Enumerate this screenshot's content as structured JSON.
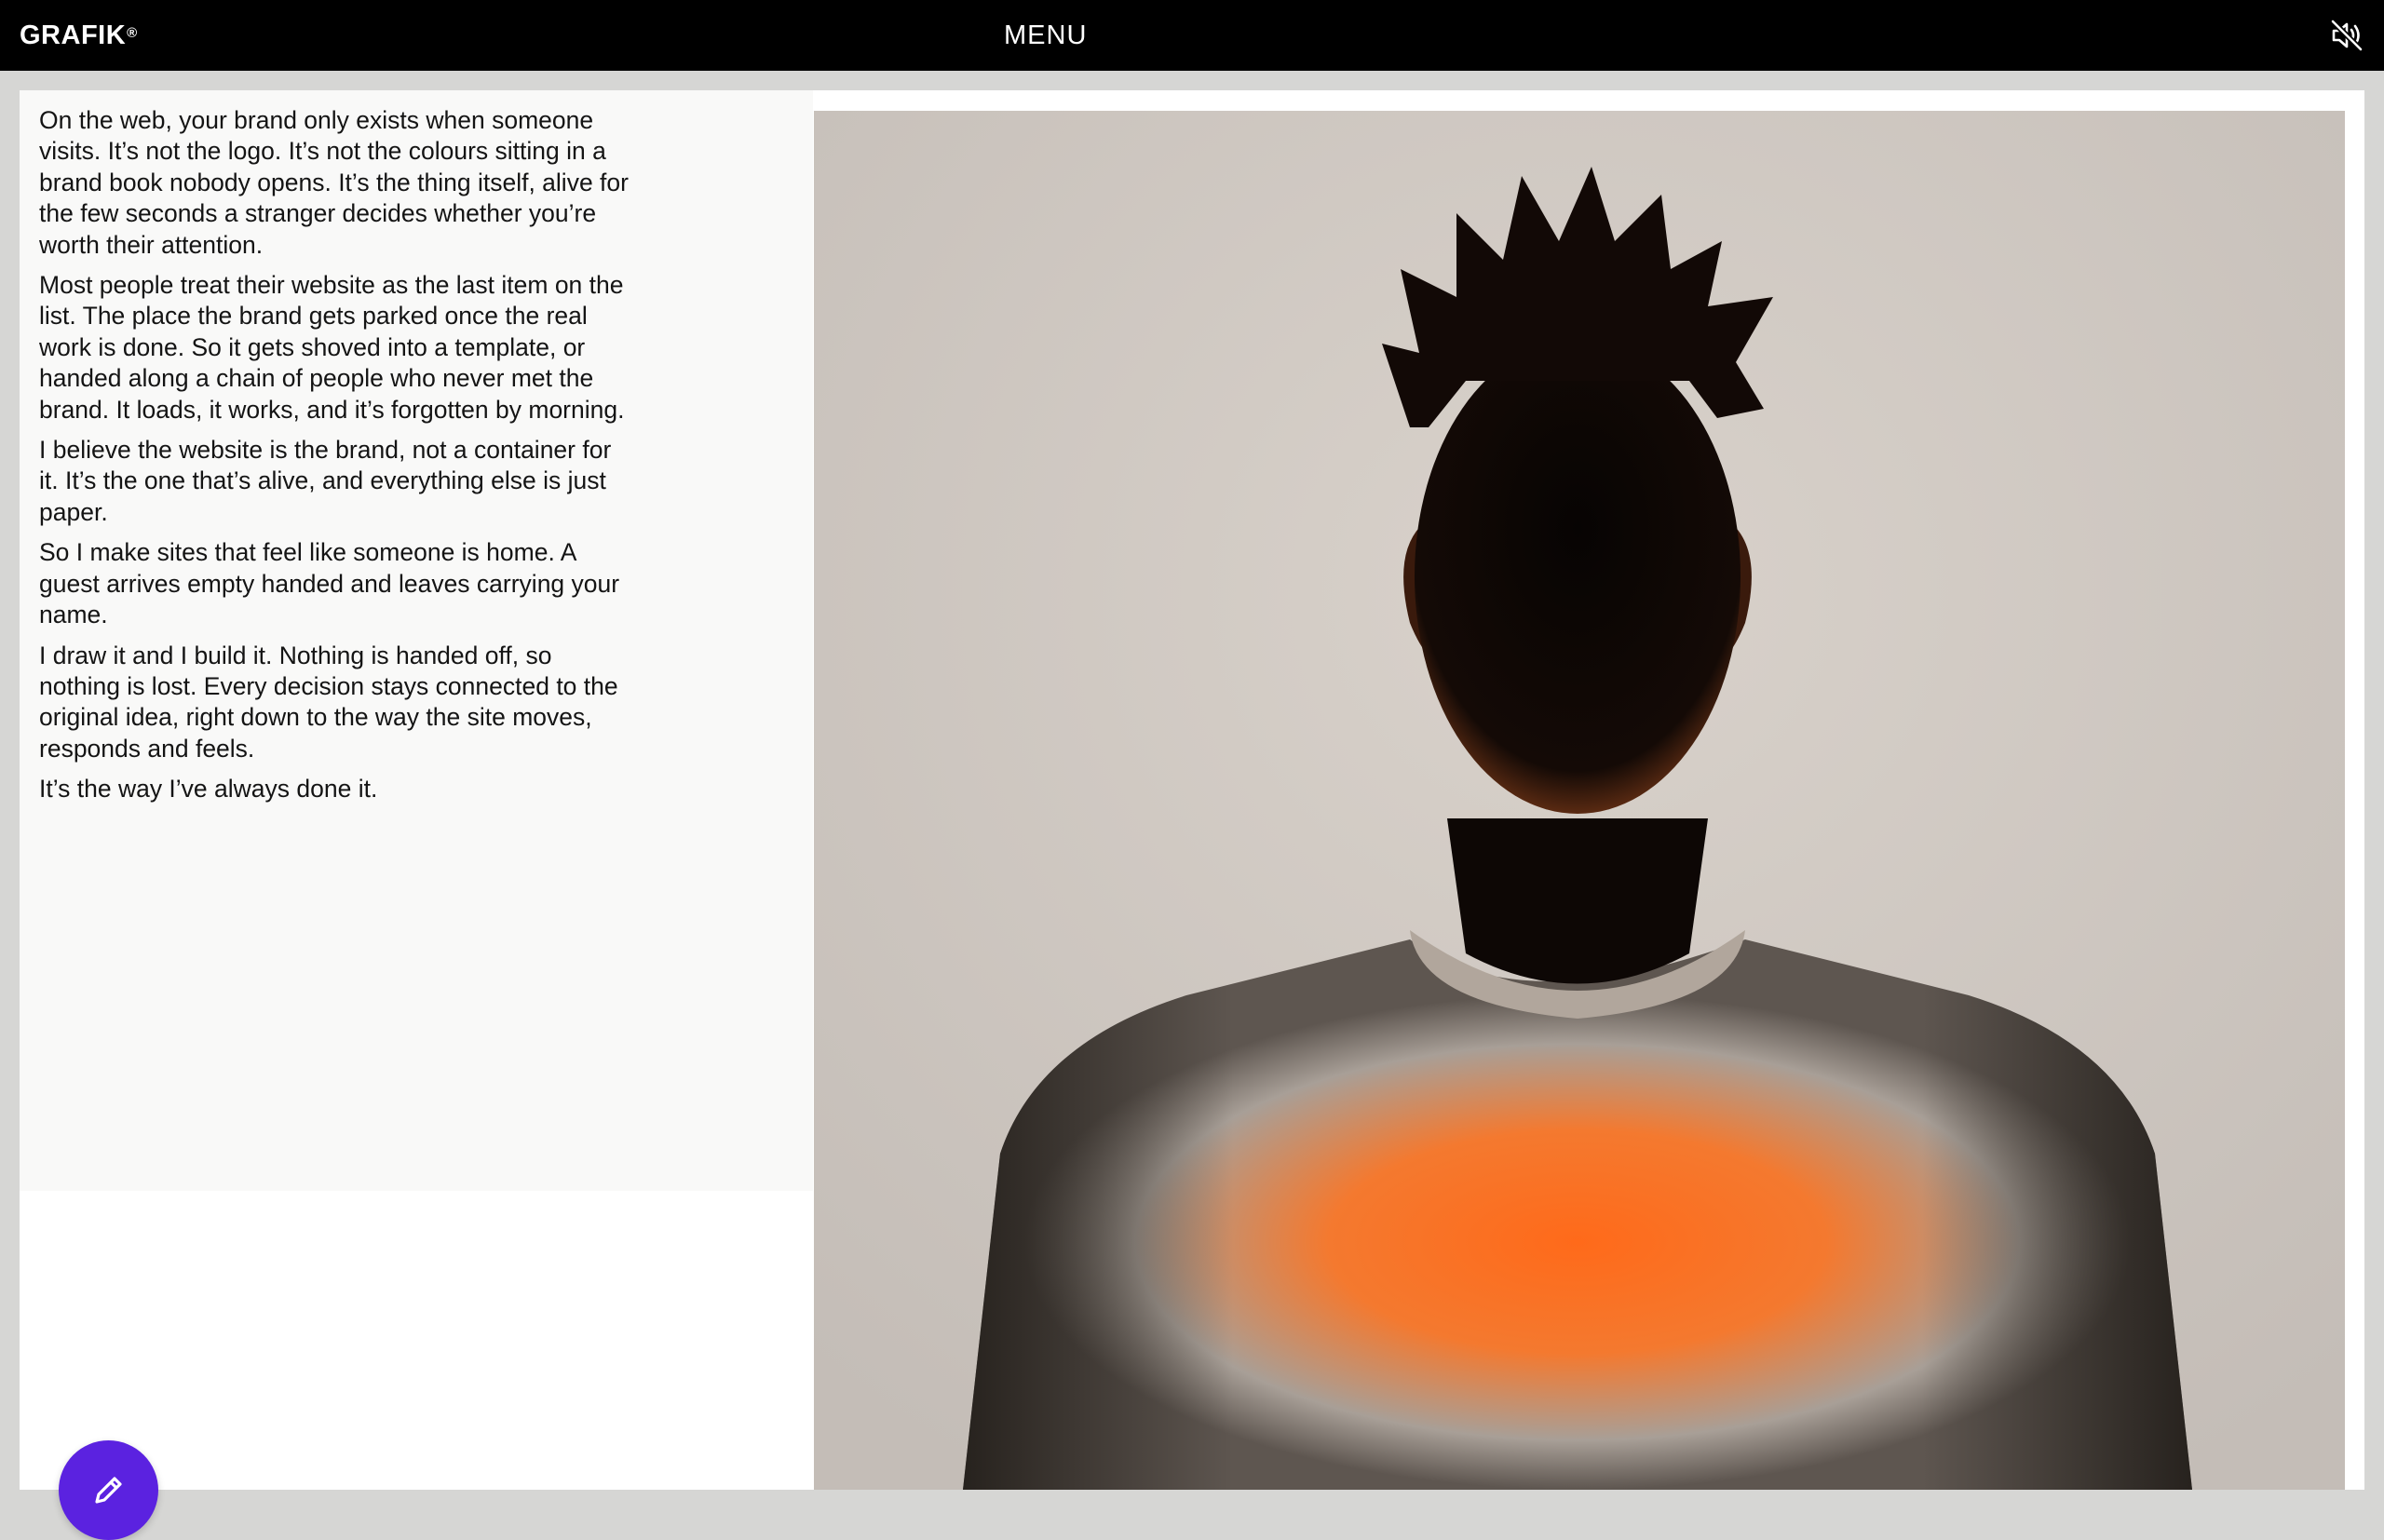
{
  "header": {
    "logo": "GRAFIK",
    "logo_mark": "®",
    "menu_label": "MENU",
    "sound_icon": "speaker-muted-icon"
  },
  "about": {
    "paragraphs": [
      "On the web, your brand only exists when someone visits. It’s not the logo. It’s not the colours sitting in a brand book nobody opens. It’s the thing itself, alive for the few seconds a stranger decides whether you’re worth their attention.",
      "Most people treat their website as the last item on the list. The place the brand gets parked once the real work is done. So it gets shoved into a template, or handed along a chain of people who never met the brand. It loads, it works, and it’s forgotten by morning.",
      "I believe the website is the brand, not a container for it. It’s the one that’s alive, and everything else is just paper.",
      "So I make sites that feel like someone is home. A guest arrives empty handed and leaves carrying your name.",
      "I draw it and I build it. Nothing is handed off, so nothing is lost. Every decision stays connected to the original idea, right down to the way the site moves, responds and feels.",
      "It’s the way I’ve always done it."
    ]
  },
  "portrait": {
    "subject": "backlit person in grey-orange sweatshirt, face in shadow"
  },
  "fab": {
    "icon": "pencil-icon",
    "color": "#5b22e0"
  },
  "colors": {
    "topbar": "#000000",
    "panel": "#f9f9f8",
    "accent": "#5b22e0",
    "sweater_glow": "#ff6a1a"
  }
}
